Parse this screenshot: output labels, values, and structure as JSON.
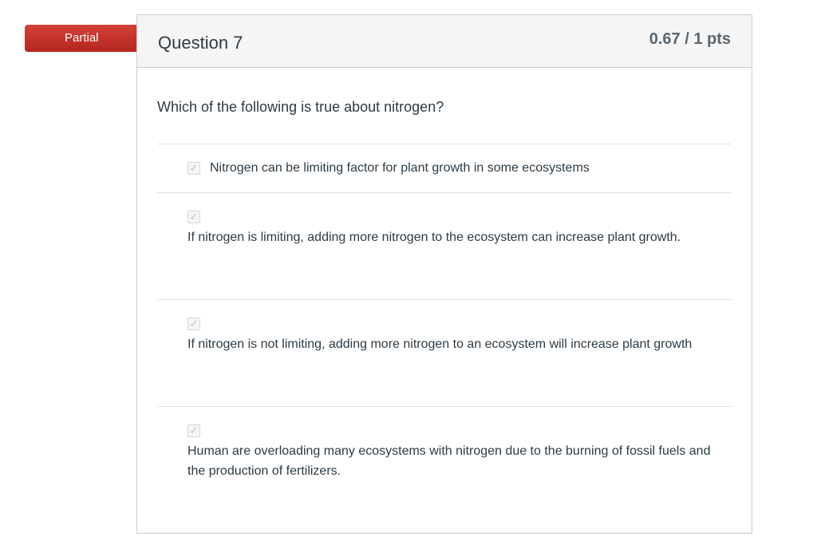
{
  "badge": {
    "label": "Partial",
    "color": "#c8302c"
  },
  "question": {
    "title": "Question 7",
    "points": "0.67 / 1 pts",
    "text": "Which of the following is true about nitrogen?"
  },
  "answers": [
    {
      "text": "Nitrogen can be limiting factor for plant growth in some ecosystems",
      "selected": true,
      "icon": "check-icon"
    },
    {
      "text": "If nitrogen is limiting, adding more nitrogen to the ecosystem can increase plant growth.",
      "selected": true,
      "icon": "check-icon"
    },
    {
      "text": "If nitrogen is not limiting, adding more nitrogen to an ecosystem will increase plant growth",
      "selected": true,
      "icon": "check-icon"
    },
    {
      "text": "Human are overloading many ecosystems with nitrogen due to the burning of fossil fuels and the production of fertilizers.",
      "selected": true,
      "icon": "check-icon"
    }
  ]
}
